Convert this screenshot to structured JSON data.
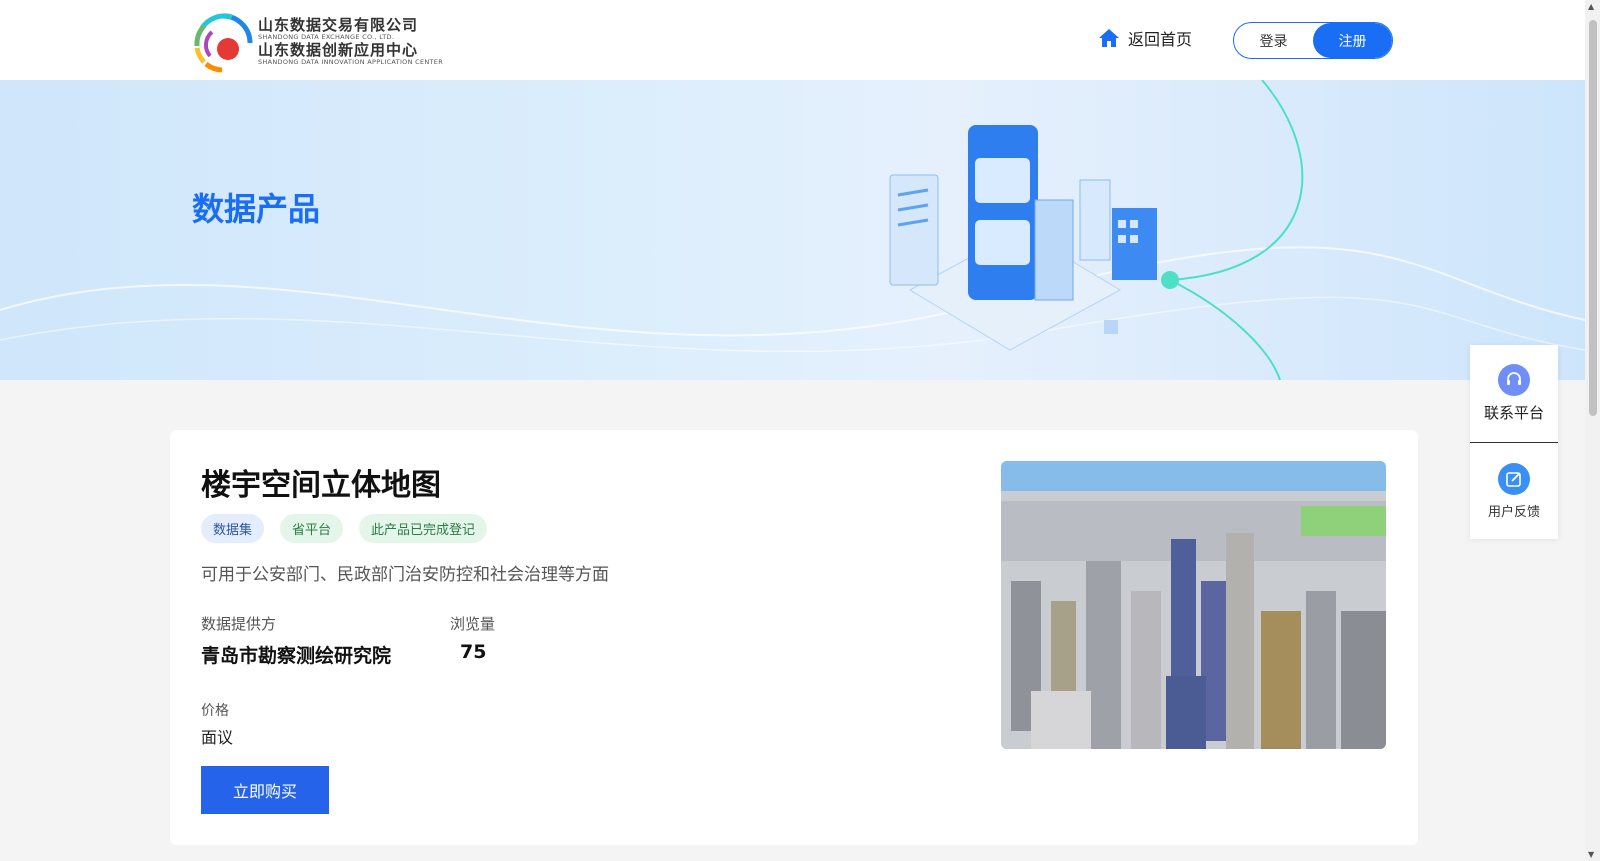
{
  "header": {
    "logo_cn_1": "山东数据交易有限公司",
    "logo_en_1": "SHANDONG DATA EXCHANGE CO., LTD.",
    "logo_cn_2": "山东数据创新应用中心",
    "logo_en_2": "SHANDONG DATA INNOVATION APPLICATION CENTER",
    "home_label": "返回首页",
    "login_label": "登录",
    "register_label": "注册"
  },
  "banner": {
    "title": "数据产品"
  },
  "product": {
    "title": "楼宇空间立体地图",
    "tags": [
      "数据集",
      "省平台",
      "此产品已完成登记"
    ],
    "description": "可用于公安部门、民政部门治安防控和社会治理等方面",
    "provider_label": "数据提供方",
    "provider_value": "青岛市勘察测绘研究院",
    "views_label": "浏览量",
    "views_value": "75",
    "price_label": "价格",
    "price_value": "面议",
    "buy_label": "立即购买"
  },
  "float_panel": {
    "contact_label": "联系平台",
    "feedback_label": "用户反馈"
  },
  "colors": {
    "accent": "#1a6ef5",
    "button": "#2563eb"
  }
}
